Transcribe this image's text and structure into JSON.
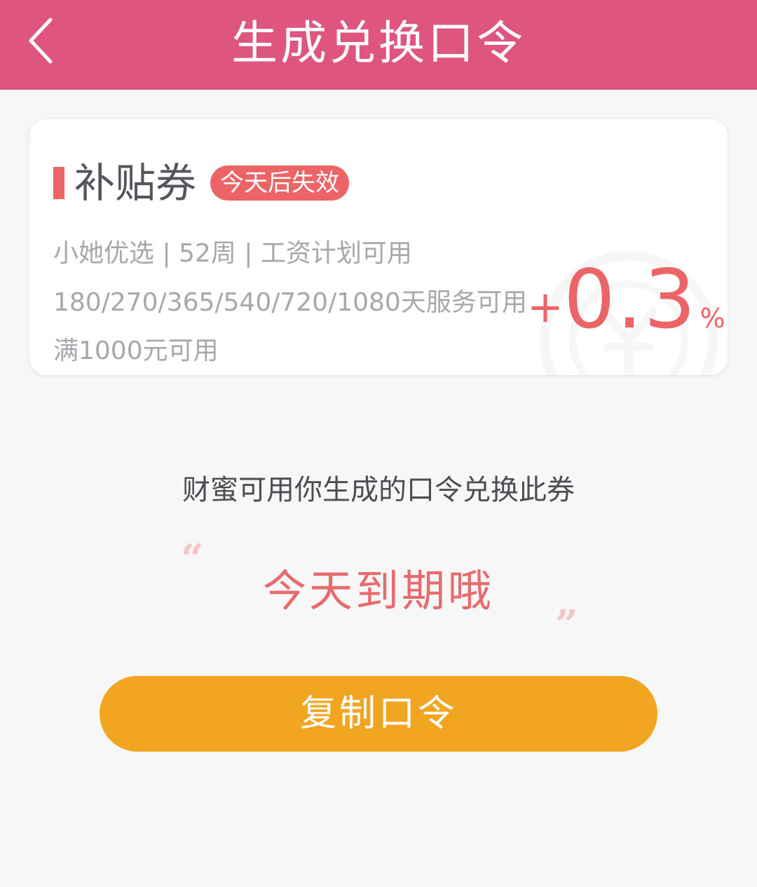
{
  "header": {
    "title": "生成兑换口令",
    "back_icon": "chevron-left-icon"
  },
  "coupon": {
    "title": "补贴券",
    "badge": "今天后失效",
    "line1": "小她优选 | 52周 | 工资计划可用",
    "line2": "180/270/365/540/720/1080天服务可用",
    "line3": "满1000元可用",
    "rate_plus": "+",
    "rate_value": "0.3",
    "rate_unit": "%"
  },
  "hint": "财蜜可用你生成的口令兑换此券",
  "code": "今天到期哦",
  "button": {
    "label": "复制口令"
  },
  "colors": {
    "header_bg": "#de5580",
    "accent_red": "#ec6466",
    "button_bg": "#f2a521"
  }
}
